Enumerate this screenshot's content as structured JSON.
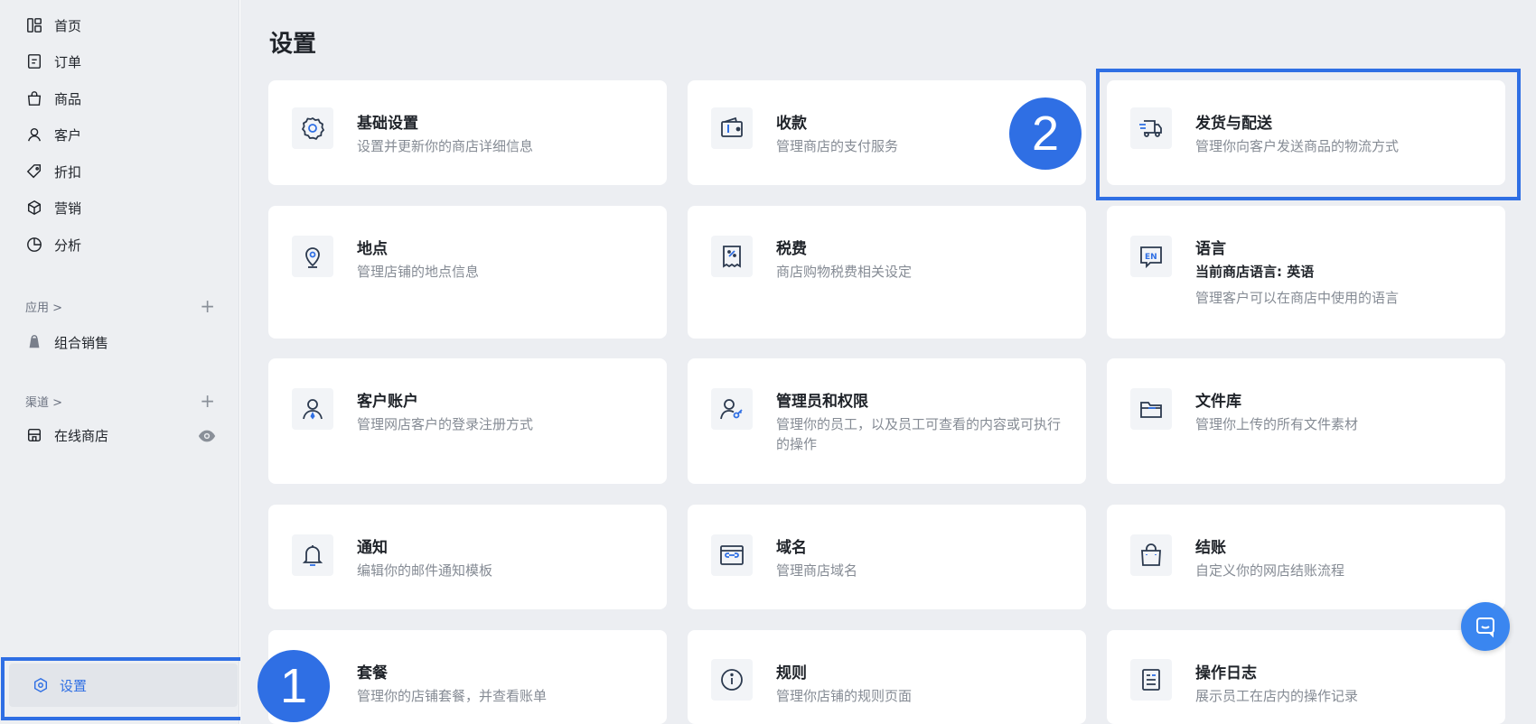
{
  "sidebar": {
    "items": [
      {
        "label": "首页",
        "icon": "dashboard-icon"
      },
      {
        "label": "订单",
        "icon": "order-icon"
      },
      {
        "label": "商品",
        "icon": "bag-icon"
      },
      {
        "label": "客户",
        "icon": "user-icon"
      },
      {
        "label": "折扣",
        "icon": "tag-icon"
      },
      {
        "label": "营销",
        "icon": "cube-icon"
      },
      {
        "label": "分析",
        "icon": "pie-chart-icon"
      }
    ],
    "apps_heading": "应用 >",
    "apps_plus": "+",
    "app_items": [
      {
        "label": "组合销售",
        "icon": "layers-icon"
      }
    ],
    "channels_heading": "渠道 >",
    "channels_plus": "+",
    "channel_items": [
      {
        "label": "在线商店",
        "icon": "store-icon"
      }
    ],
    "settings_label": "设置"
  },
  "main": {
    "title": "设置",
    "cards": [
      {
        "title": "基础设置",
        "desc": "设置并更新你的商店详细信息"
      },
      {
        "title": "收款",
        "desc": "管理商店的支付服务"
      },
      {
        "title": "发货与配送",
        "desc": "管理你向客户发送商品的物流方式"
      },
      {
        "title": "地点",
        "desc": "管理店铺的地点信息"
      },
      {
        "title": "税费",
        "desc": "商店购物税费相关设定"
      },
      {
        "title": "语言",
        "sub": "当前商店语言: 英语",
        "desc": "管理客户可以在商店中使用的语言"
      },
      {
        "title": "客户账户",
        "desc": "管理网店客户的登录注册方式"
      },
      {
        "title": "管理员和权限",
        "desc": "管理你的员工，以及员工可查看的内容或可执行的操作"
      },
      {
        "title": "文件库",
        "desc": "管理你上传的所有文件素材"
      },
      {
        "title": "通知",
        "desc": "编辑你的邮件通知模板"
      },
      {
        "title": "域名",
        "desc": "管理商店域名"
      },
      {
        "title": "结账",
        "desc": "自定义你的网店结账流程"
      },
      {
        "title": "套餐",
        "desc": "管理你的店铺套餐，并查看账单"
      },
      {
        "title": "规则",
        "desc": "管理你店铺的规则页面"
      },
      {
        "title": "操作日志",
        "desc": "展示员工在店内的操作记录"
      }
    ]
  },
  "annotations": {
    "badge1": "1",
    "badge2": "2"
  },
  "colors": {
    "accent": "#2f6fe4",
    "badge": "#2f6fe4",
    "chat": "#3a86f0"
  }
}
